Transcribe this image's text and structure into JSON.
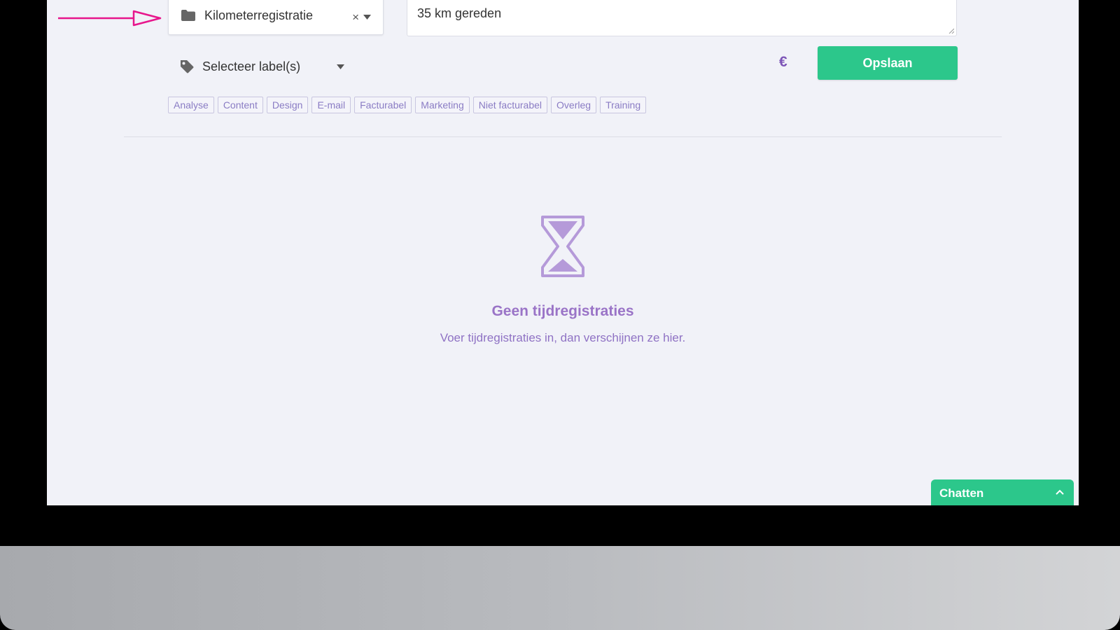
{
  "project_select": {
    "value": "Kilometerregistratie",
    "clear_symbol": "×"
  },
  "description": {
    "value": "35 km gereden"
  },
  "label_select": {
    "placeholder": "Selecteer label(s)"
  },
  "currency_symbol": "€",
  "save_button": "Opslaan",
  "tags": [
    "Analyse",
    "Content",
    "Design",
    "E-mail",
    "Facturabel",
    "Marketing",
    "Niet facturabel",
    "Overleg",
    "Training"
  ],
  "empty_state": {
    "title": "Geen tijdregistraties",
    "subtitle": "Voer tijdregistraties in, dan verschijnen ze hier."
  },
  "chat": {
    "label": "Chatten"
  },
  "icons": [
    "folder-icon",
    "tag-icon",
    "hourglass-icon",
    "arrow-annotation",
    "chevron-up-icon"
  ],
  "colors": {
    "accent_green": "#2cc78b",
    "purple": "#9a74c7",
    "annotation_pink": "#e7168c"
  }
}
